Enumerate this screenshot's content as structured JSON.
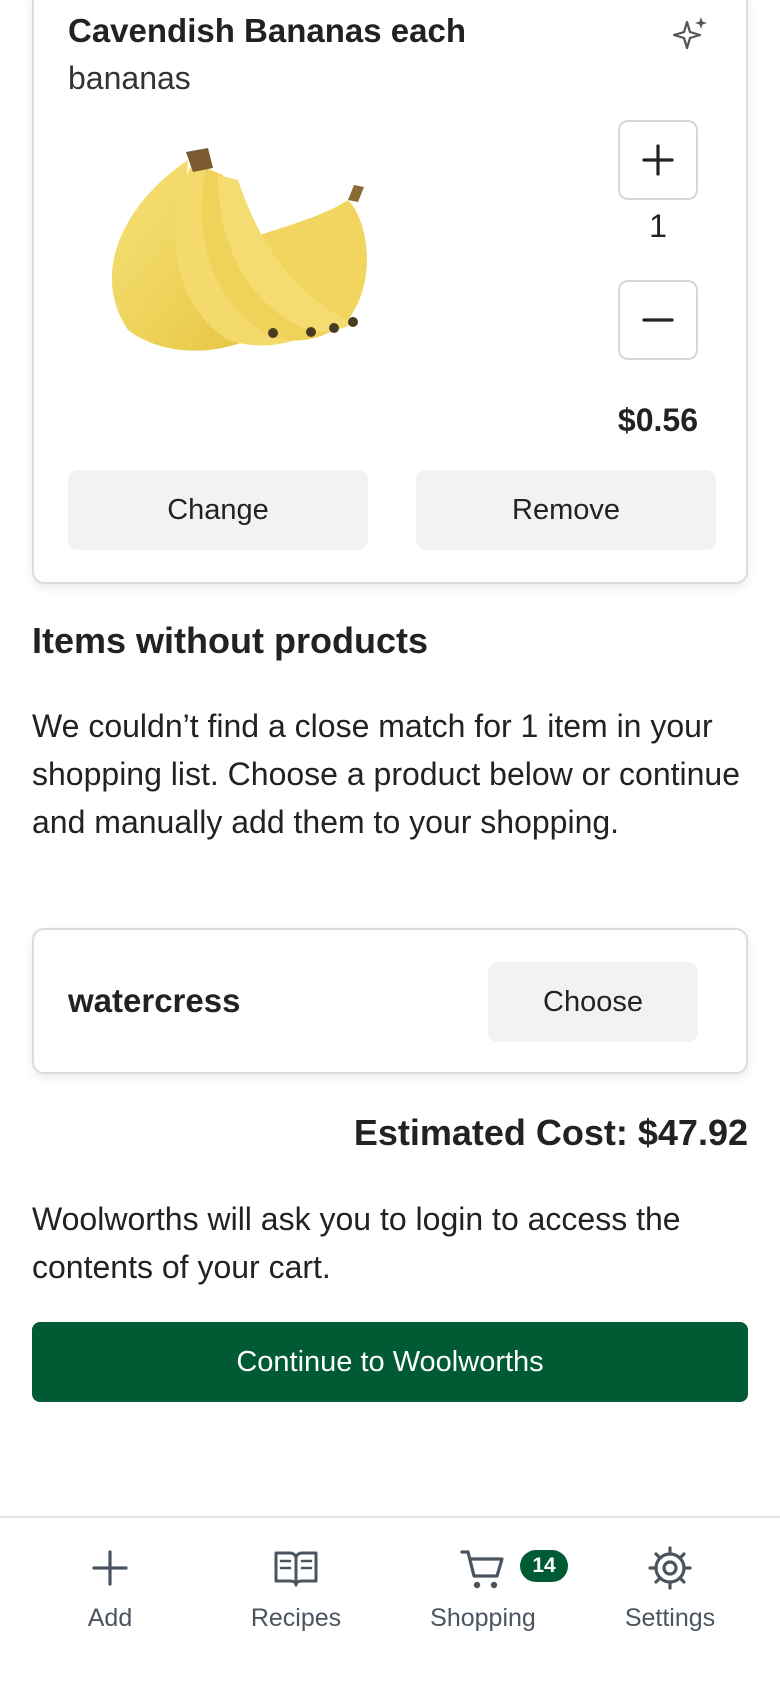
{
  "product": {
    "name": "Cavendish Bananas each",
    "subtitle": "bananas",
    "quantity": "1",
    "price": "$0.56",
    "change_label": "Change",
    "remove_label": "Remove",
    "image_icon": "banana-bunch"
  },
  "unmatched": {
    "title": "Items without products",
    "description": "We couldn’t find a close match for 1 item in your shopping list. Choose a product below or continue and manually add them to your shopping.",
    "items": [
      {
        "name": "watercress",
        "choose_label": "Choose"
      }
    ]
  },
  "summary": {
    "estimated_cost": "Estimated Cost: $47.92",
    "login_note": "Woolworths will ask you to login to access the contents of your cart.",
    "continue_label": "Continue to Woolworths"
  },
  "nav": {
    "add_label": "Add",
    "recipes_label": "Recipes",
    "shopping_label": "Shopping",
    "settings_label": "Settings",
    "shopping_badge": "14"
  },
  "colors": {
    "brand_green": "#005a33",
    "button_bg": "#f2f2f2",
    "nav_text": "#4a5560"
  }
}
